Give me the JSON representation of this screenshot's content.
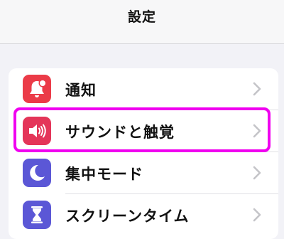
{
  "header": {
    "title": "設定"
  },
  "settings": {
    "items": [
      {
        "label": "通知",
        "icon": "bell-badge-icon",
        "icon_color": "#eb3b48"
      },
      {
        "label": "サウンドと触覚",
        "icon": "speaker-wave-icon",
        "icon_color": "#e43559"
      },
      {
        "label": "集中モード",
        "icon": "moon-icon",
        "icon_color": "#5b57d6"
      },
      {
        "label": "スクリーンタイム",
        "icon": "hourglass-icon",
        "icon_color": "#5b57d6"
      }
    ]
  },
  "highlight": {
    "color": "#f000f0",
    "target": "サウンドと触覚"
  }
}
